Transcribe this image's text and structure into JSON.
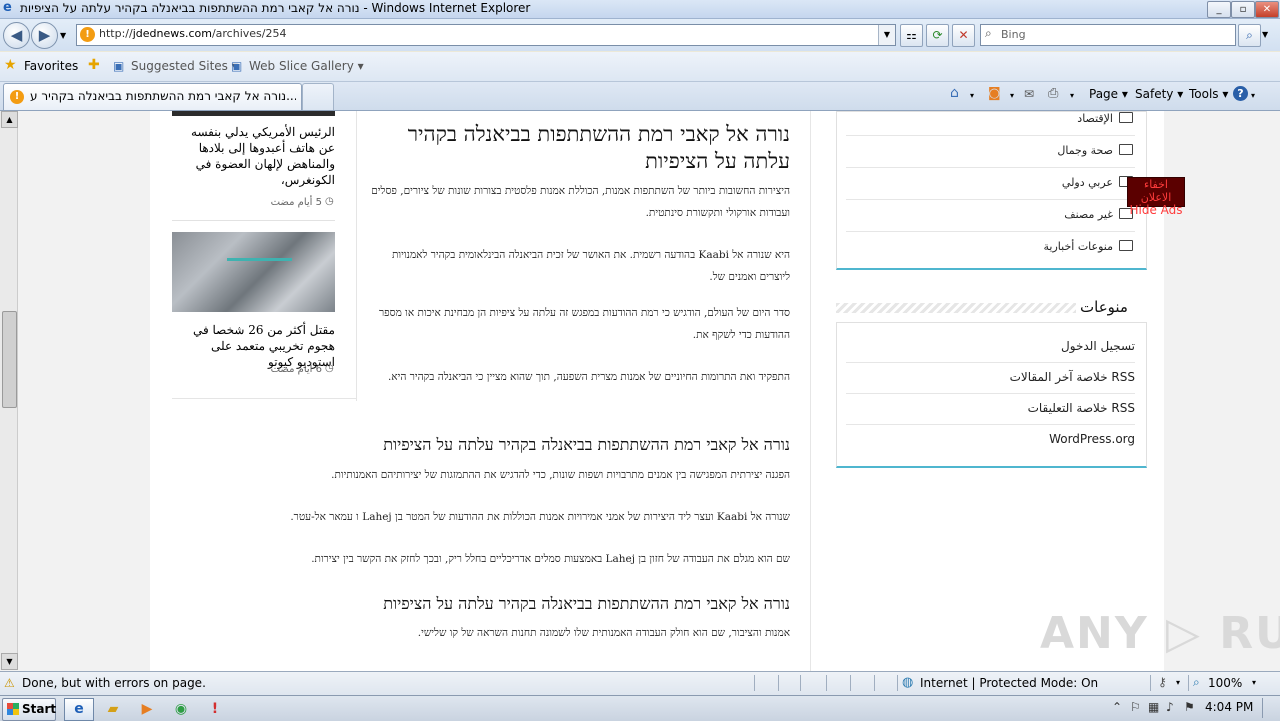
{
  "window": {
    "title": "נורה אל קאבי רמת ההשתתפות בביאנלה בקהיר עלתה על הציפיות - Windows Internet Explorer",
    "minimize": "_",
    "maximize": "▫",
    "close": "✕"
  },
  "addressbar": {
    "protocol": "http://",
    "domain": "jdednews.com",
    "path": "/archives/254"
  },
  "search": {
    "placeholder": "Bing"
  },
  "favorites": {
    "label": "Favorites",
    "items": [
      "Suggested Sites ▾",
      "Web Slice Gallery ▾"
    ]
  },
  "tab": {
    "title": "נורה אל קאבי רמת ההשתתפות בביאנלה בקהיר ע..."
  },
  "commandbar": {
    "page": "Page ▾",
    "safety": "Safety ▾",
    "tools": "Tools ▾"
  },
  "left_widget": {
    "item1": {
      "text": "الرئيس الأمريكي يدلي بنفسه عن هاتف أعبدوها إلى بلادها والمناهض لإلهان العضوة في الكونغرس،",
      "date": "5 أيام مضت"
    },
    "item2": {
      "text": "مقتل أكثر من 26 شخصا في هجوم تخريبي متعمد على استوديو كيوتو",
      "date": "6 أيام مضت"
    }
  },
  "article": {
    "title": "נורה אל קאבי רמת ההשתתפות בביאנלה בקהיר עלתה על הציפיות",
    "paragraphs": [
      "היצירות החשובות ביותר של השתתפות אמנות, הכוללת אמנות פלסטית בצורות שונות של ציורים, פסלים ועבודות אורקולי ותקשורת סינתטית.",
      "היא שנורה אל Kaabi בהודעה רשמית. את האושר של זכית הביאנלה הבינלאומית בקהיר לאמנויות ליוצרים ואמנים של.",
      "סדר היום של העולם, הודגיש כי רמת ההודעות במפגש זה עלתה על ציפיות הן מבחינת איכות או מספר ההודעות כדי לשקף את.",
      "התפקיד ואת התרומות החיוניים של אמנות מצרית השפעה, תוך שהוא מציין כי הביאנלה בקהיר היא."
    ],
    "subhead1": "נורה אל קאבי רמת ההשתתפות בביאנלה בקהיר עלתה על הציפיות",
    "paragraphs2": [
      "הפגנה יצירתית המפגישה בין אמנים מתרבויות ושפות שונות, כדי להדגיש את ההתמזגות של יצירותיהם האמנותיות.",
      "שנורה אל Kaabi ועצר ליד היצירות של אמני אמירויות אמנות הכוללות את ההודעות של המטר בן Lahej ו עמאר אל-עטר.",
      "שם הוא מגלם את העבודה של חזון בן Lahej באמצעות סמלים אדריכליים בחלל ריק, ובכך לחזק את הקשר בין יצירות."
    ],
    "subhead2": "נורה אל קאבי רמת ההשתתפות בביאנלה בקהיר עלתה על הציפיות",
    "paragraph3": "אמנות והציבור, שם הוא חולק העבודה האמנותית שלו לשמונה תחנות השראה של קו שלישי."
  },
  "sidebar": {
    "categories": [
      "الإقتصاد",
      "صحة وجمال",
      "عربي دولي",
      "غير مصنف",
      "منوعات أخبارية"
    ],
    "meta_title": "منوعات",
    "meta_items": [
      "تسجيل الدخول",
      "خلاصة آخر المقالات RSS",
      "خلاصة التعليقات RSS",
      "WordPress.org"
    ]
  },
  "hide_ads": {
    "ar": "اخفاء الاعلان",
    "en": "Hide Ads"
  },
  "watermark": "ANY ▷ RUN",
  "statusbar": {
    "message": "Done, but with errors on page.",
    "zone": "Internet | Protected Mode: On",
    "zoom": "100%"
  },
  "taskbar": {
    "start": "Start",
    "clock": "4:04 PM"
  }
}
